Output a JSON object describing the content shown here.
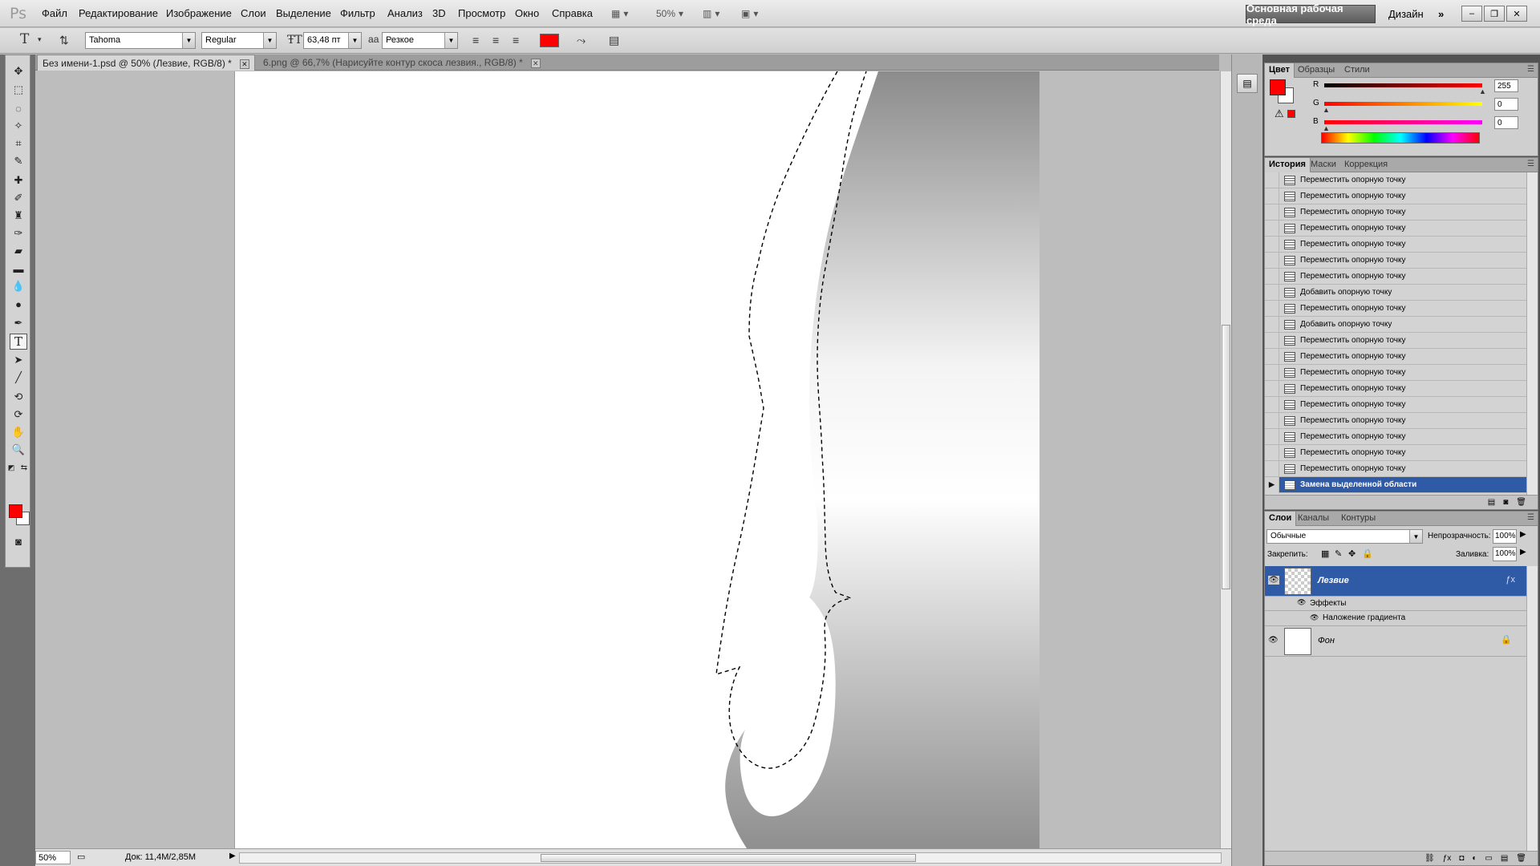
{
  "app": {
    "logo": "Ps"
  },
  "menu": [
    "Файл",
    "Редактирование",
    "Изображение",
    "Слои",
    "Выделение",
    "Фильтр",
    "Анализ",
    "3D",
    "Просмотр",
    "Окно",
    "Справка"
  ],
  "menubar_controls": {
    "zoom": "50%"
  },
  "workspace": {
    "active": "Основная рабочая среда",
    "other": "Дизайн",
    "more": "»"
  },
  "window_controls": [
    "–",
    "❐",
    "✕"
  ],
  "options": {
    "tool_glyph": "T",
    "font_family": "Tahoma",
    "font_style": "Regular",
    "font_size": "63,48 пт",
    "aa_label": "a",
    "antialias": "Резкое",
    "text_color": "#ff0000"
  },
  "tabs": [
    {
      "label": "Без имени-1.psd @ 50% (Лезвие, RGB/8) *",
      "active": true
    },
    {
      "label": "6.png @ 66,7% (Нарисуйте контур скоса лезвия., RGB/8) *",
      "active": false
    }
  ],
  "status": {
    "zoom": "50%",
    "doc_info": "Док: 11,4M/2,85M"
  },
  "color_panel": {
    "tabs": [
      "Цвет",
      "Образцы",
      "Стили"
    ],
    "fg": "#ff0000",
    "bg": "#ffffff",
    "channels": [
      {
        "label": "R",
        "value": "255"
      },
      {
        "label": "G",
        "value": "0"
      },
      {
        "label": "B",
        "value": "0"
      }
    ]
  },
  "history_panel": {
    "tabs": [
      "История",
      "Маски",
      "Коррекция"
    ],
    "items": [
      "Переместить опорную точку",
      "Переместить опорную точку",
      "Переместить опорную точку",
      "Переместить опорную точку",
      "Переместить опорную точку",
      "Переместить опорную точку",
      "Переместить опорную точку",
      "Добавить опорную точку",
      "Переместить опорную точку",
      "Добавить опорную точку",
      "Переместить опорную точку",
      "Переместить опорную точку",
      "Переместить опорную точку",
      "Переместить опорную точку",
      "Переместить опорную точку",
      "Переместить опорную точку",
      "Переместить опорную точку",
      "Переместить опорную точку",
      "Переместить опорную точку",
      "Замена выделенной области"
    ]
  },
  "layers_panel": {
    "tabs": [
      "Слои",
      "Каналы",
      "Контуры"
    ],
    "blend_mode": "Обычные",
    "opacity_label": "Непрозрачность:",
    "opacity": "100%",
    "lock_label": "Закрепить:",
    "fill_label": "Заливка:",
    "fill": "100%",
    "layers": [
      {
        "name": "Лезвие",
        "effects_label": "Эффекты",
        "effect": "Наложение градиента"
      },
      {
        "name": "Фон"
      }
    ]
  }
}
